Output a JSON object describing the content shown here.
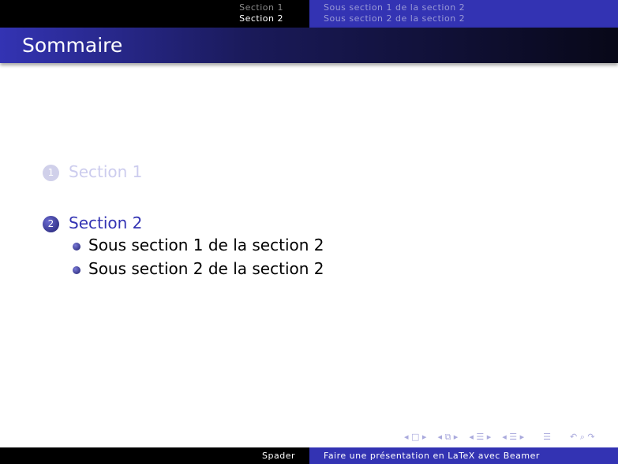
{
  "header": {
    "sections": [
      "Section 1",
      "Section 2"
    ],
    "subsections": [
      "Sous section 1 de la section 2",
      "Sous section 2 de la section 2"
    ]
  },
  "title": "Sommaire",
  "toc": [
    {
      "num": "1",
      "label": "Section 1"
    },
    {
      "num": "2",
      "label": "Section 2",
      "subs": [
        "Sous section 1 de la section 2",
        "Sous section 2 de la section 2"
      ]
    }
  ],
  "nav": {
    "frame": "◂ □ ▸",
    "subsection": "◂ ⧉ ▸",
    "section": "◂ ☰ ▸",
    "subsec2": "◂ ☰ ▸",
    "doc": "☰",
    "search": "↶ ⌕ ↷"
  },
  "footer": {
    "author": "Spader",
    "title": "Faire une présentation en LaTeX avec Beamer"
  }
}
